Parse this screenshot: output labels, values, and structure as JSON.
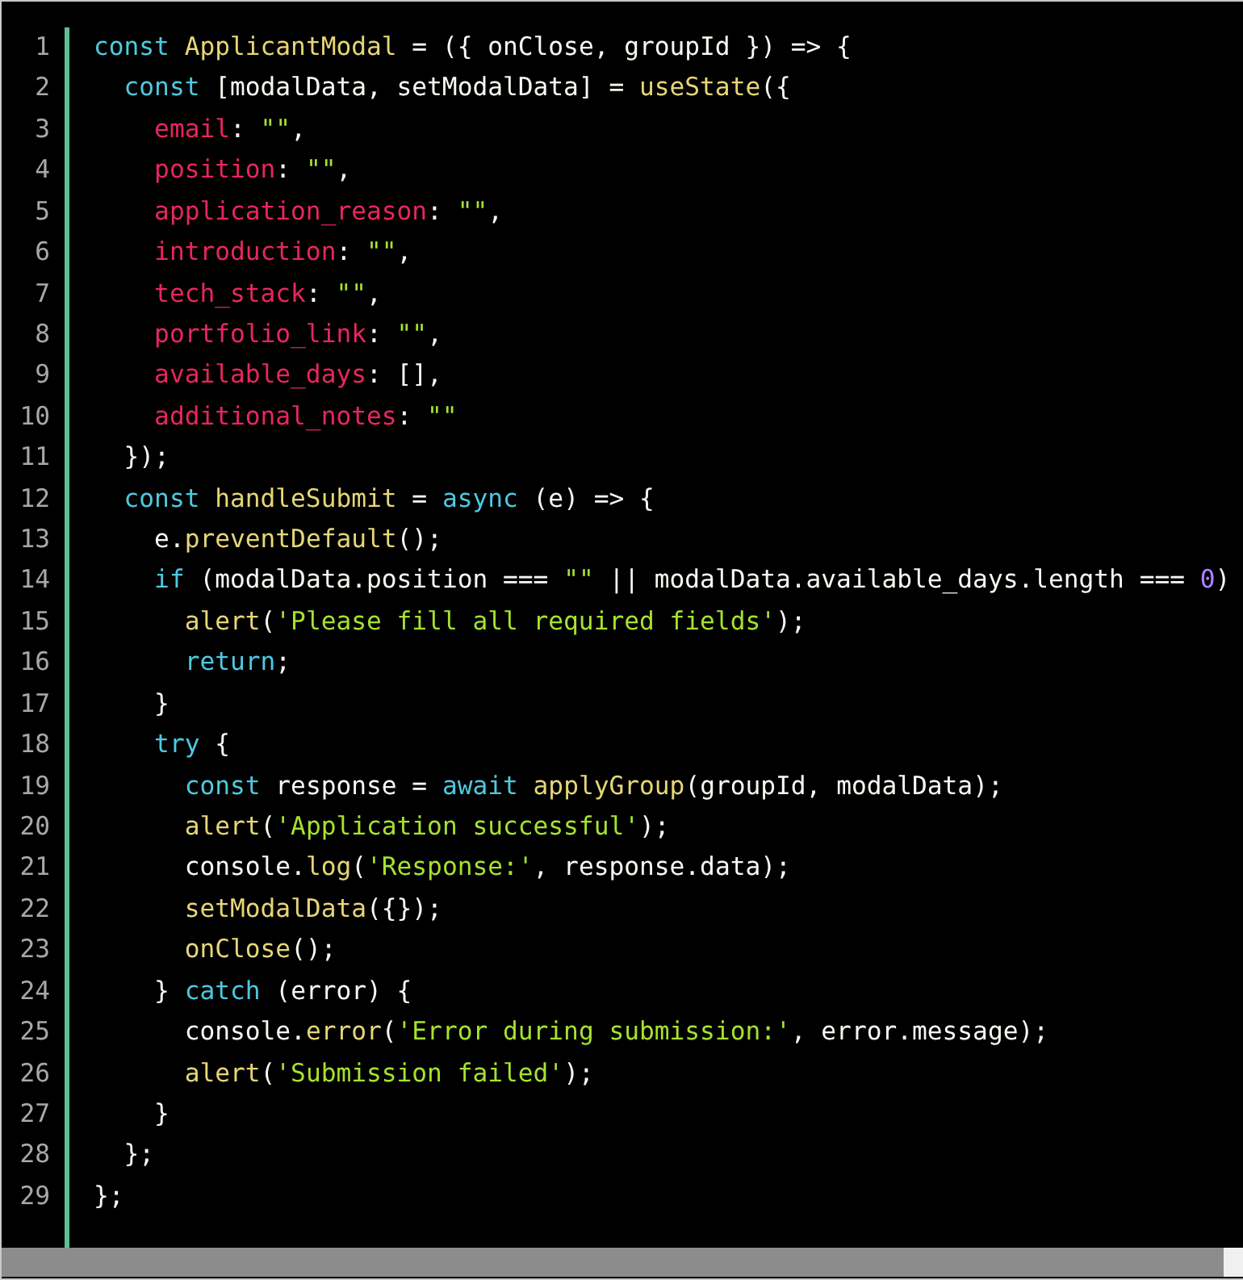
{
  "code": {
    "lines": [
      {
        "number": "1",
        "tokens": [
          {
            "kind": "keyword",
            "text": "const"
          },
          {
            "kind": "function",
            "text": " ApplicantModal"
          },
          {
            "kind": "plain",
            "text": " = ({ onClose, groupId }) => {"
          }
        ]
      },
      {
        "number": "2",
        "tokens": [
          {
            "kind": "keyword",
            "text": "  const"
          },
          {
            "kind": "plain",
            "text": " [modalData, setModalData] = "
          },
          {
            "kind": "function",
            "text": "useState"
          },
          {
            "kind": "plain",
            "text": "({"
          }
        ]
      },
      {
        "number": "3",
        "tokens": [
          {
            "kind": "property",
            "text": "    email"
          },
          {
            "kind": "plain",
            "text": ": "
          },
          {
            "kind": "string",
            "text": "\"\""
          },
          {
            "kind": "plain",
            "text": ","
          }
        ]
      },
      {
        "number": "4",
        "tokens": [
          {
            "kind": "property",
            "text": "    position"
          },
          {
            "kind": "plain",
            "text": ": "
          },
          {
            "kind": "string",
            "text": "\"\""
          },
          {
            "kind": "plain",
            "text": ","
          }
        ]
      },
      {
        "number": "5",
        "tokens": [
          {
            "kind": "property",
            "text": "    application_reason"
          },
          {
            "kind": "plain",
            "text": ": "
          },
          {
            "kind": "string",
            "text": "\"\""
          },
          {
            "kind": "plain",
            "text": ","
          }
        ]
      },
      {
        "number": "6",
        "tokens": [
          {
            "kind": "property",
            "text": "    introduction"
          },
          {
            "kind": "plain",
            "text": ": "
          },
          {
            "kind": "string",
            "text": "\"\""
          },
          {
            "kind": "plain",
            "text": ","
          }
        ]
      },
      {
        "number": "7",
        "tokens": [
          {
            "kind": "property",
            "text": "    tech_stack"
          },
          {
            "kind": "plain",
            "text": ": "
          },
          {
            "kind": "string",
            "text": "\"\""
          },
          {
            "kind": "plain",
            "text": ","
          }
        ]
      },
      {
        "number": "8",
        "tokens": [
          {
            "kind": "property",
            "text": "    portfolio_link"
          },
          {
            "kind": "plain",
            "text": ": "
          },
          {
            "kind": "string",
            "text": "\"\""
          },
          {
            "kind": "plain",
            "text": ","
          }
        ]
      },
      {
        "number": "9",
        "tokens": [
          {
            "kind": "property",
            "text": "    available_days"
          },
          {
            "kind": "plain",
            "text": ": [],"
          }
        ]
      },
      {
        "number": "10",
        "tokens": [
          {
            "kind": "property",
            "text": "    additional_notes"
          },
          {
            "kind": "plain",
            "text": ": "
          },
          {
            "kind": "string",
            "text": "\"\""
          }
        ]
      },
      {
        "number": "11",
        "tokens": [
          {
            "kind": "plain",
            "text": "  });"
          }
        ]
      },
      {
        "number": "12",
        "tokens": [
          {
            "kind": "keyword",
            "text": "  const"
          },
          {
            "kind": "function",
            "text": " handleSubmit"
          },
          {
            "kind": "plain",
            "text": " = "
          },
          {
            "kind": "keyword",
            "text": "async"
          },
          {
            "kind": "plain",
            "text": " (e) => {"
          }
        ]
      },
      {
        "number": "13",
        "tokens": [
          {
            "kind": "plain",
            "text": "    e."
          },
          {
            "kind": "function",
            "text": "preventDefault"
          },
          {
            "kind": "plain",
            "text": "();"
          }
        ]
      },
      {
        "number": "14",
        "tokens": [
          {
            "kind": "keyword",
            "text": "    if"
          },
          {
            "kind": "plain",
            "text": " (modalData.position === "
          },
          {
            "kind": "string",
            "text": "\"\""
          },
          {
            "kind": "plain",
            "text": " || modalData.available_days.length === "
          },
          {
            "kind": "number",
            "text": "0"
          },
          {
            "kind": "plain",
            "text": ")"
          }
        ]
      },
      {
        "number": "15",
        "tokens": [
          {
            "kind": "function",
            "text": "      alert"
          },
          {
            "kind": "plain",
            "text": "("
          },
          {
            "kind": "string",
            "text": "'Please fill all required fields'"
          },
          {
            "kind": "plain",
            "text": ");"
          }
        ]
      },
      {
        "number": "16",
        "tokens": [
          {
            "kind": "keyword",
            "text": "      return"
          },
          {
            "kind": "plain",
            "text": ";"
          }
        ]
      },
      {
        "number": "17",
        "tokens": [
          {
            "kind": "plain",
            "text": "    }"
          }
        ]
      },
      {
        "number": "18",
        "tokens": [
          {
            "kind": "keyword",
            "text": "    try"
          },
          {
            "kind": "plain",
            "text": " {"
          }
        ]
      },
      {
        "number": "19",
        "tokens": [
          {
            "kind": "keyword",
            "text": "      const"
          },
          {
            "kind": "plain",
            "text": " response = "
          },
          {
            "kind": "keyword",
            "text": "await"
          },
          {
            "kind": "function",
            "text": " applyGroup"
          },
          {
            "kind": "plain",
            "text": "(groupId, modalData);"
          }
        ]
      },
      {
        "number": "20",
        "tokens": [
          {
            "kind": "function",
            "text": "      alert"
          },
          {
            "kind": "plain",
            "text": "("
          },
          {
            "kind": "string",
            "text": "'Application successful'"
          },
          {
            "kind": "plain",
            "text": ");"
          }
        ]
      },
      {
        "number": "21",
        "tokens": [
          {
            "kind": "plain",
            "text": "      console."
          },
          {
            "kind": "function",
            "text": "log"
          },
          {
            "kind": "plain",
            "text": "("
          },
          {
            "kind": "string",
            "text": "'Response:'"
          },
          {
            "kind": "plain",
            "text": ", response.data);"
          }
        ]
      },
      {
        "number": "22",
        "tokens": [
          {
            "kind": "function",
            "text": "      setModalData"
          },
          {
            "kind": "plain",
            "text": "({});"
          }
        ]
      },
      {
        "number": "23",
        "tokens": [
          {
            "kind": "function",
            "text": "      onClose"
          },
          {
            "kind": "plain",
            "text": "();"
          }
        ]
      },
      {
        "number": "24",
        "tokens": [
          {
            "kind": "plain",
            "text": "    } "
          },
          {
            "kind": "keyword",
            "text": "catch"
          },
          {
            "kind": "plain",
            "text": " (error) {"
          }
        ]
      },
      {
        "number": "25",
        "tokens": [
          {
            "kind": "plain",
            "text": "      console."
          },
          {
            "kind": "function",
            "text": "error"
          },
          {
            "kind": "plain",
            "text": "("
          },
          {
            "kind": "string",
            "text": "'Error during submission:'"
          },
          {
            "kind": "plain",
            "text": ", error.message);"
          }
        ]
      },
      {
        "number": "26",
        "tokens": [
          {
            "kind": "function",
            "text": "      alert"
          },
          {
            "kind": "plain",
            "text": "("
          },
          {
            "kind": "string",
            "text": "'Submission failed'"
          },
          {
            "kind": "plain",
            "text": ");"
          }
        ]
      },
      {
        "number": "27",
        "tokens": [
          {
            "kind": "plain",
            "text": "    }"
          }
        ]
      },
      {
        "number": "28",
        "tokens": [
          {
            "kind": "plain",
            "text": "  };"
          }
        ]
      },
      {
        "number": "29",
        "tokens": [
          {
            "kind": "plain",
            "text": "};"
          }
        ]
      }
    ]
  }
}
